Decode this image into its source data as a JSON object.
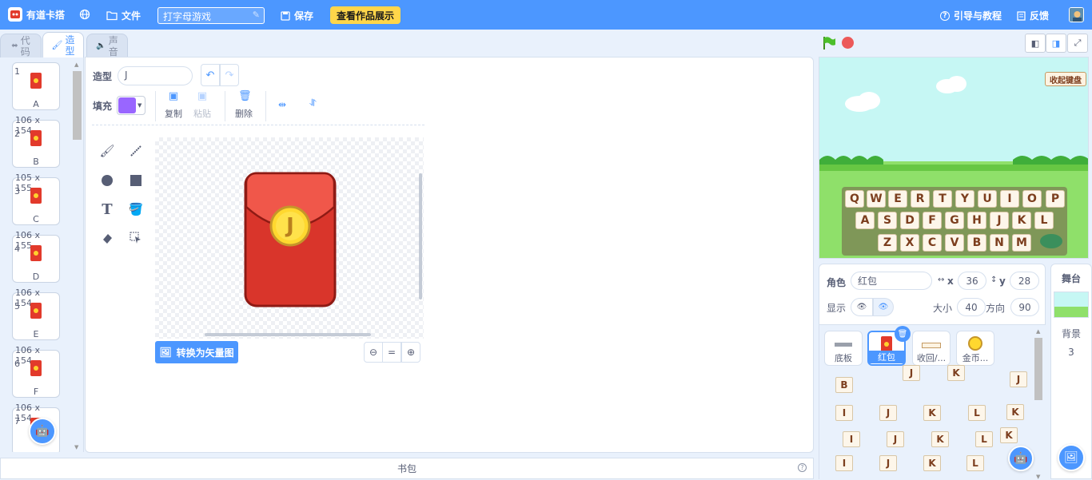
{
  "header": {
    "brand": "有道卡搭",
    "file_label": "文件",
    "project_name": "打字母游戏",
    "save_label": "保存",
    "showcase_label": "查看作品展示",
    "tutorial_label": "引导与教程",
    "feedback_label": "反馈"
  },
  "tabs": [
    {
      "label": "代码",
      "icon": "code-icon"
    },
    {
      "label": "造型",
      "icon": "brush-icon"
    },
    {
      "label": "声音",
      "icon": "speaker-icon"
    }
  ],
  "costumes": [
    {
      "num": "1",
      "name": "A",
      "size": ""
    },
    {
      "num": "2",
      "name": "B",
      "size": "106 x 154"
    },
    {
      "num": "3",
      "name": "C",
      "size": "105 x 155"
    },
    {
      "num": "4",
      "name": "D",
      "size": "106 x 155"
    },
    {
      "num": "5",
      "name": "E",
      "size": "106 x 154"
    },
    {
      "num": "6",
      "name": "F",
      "size": "106 x 154"
    },
    {
      "num": "7",
      "name": "",
      "size": "106 x 154"
    }
  ],
  "paint_editor": {
    "costume_label": "造型",
    "costume_name": "J",
    "fill_label": "填充",
    "fill_color": "#9966ff",
    "copy_label": "复制",
    "paste_label": "粘贴",
    "delete_label": "删除",
    "convert_label": "转换为矢量图",
    "envelope_letter": "J"
  },
  "backpack_label": "书包",
  "stage": {
    "fold_keyboard_label": "收起键盘",
    "keyboard_rows": [
      [
        "Q",
        "W",
        "E",
        "R",
        "T",
        "Y",
        "U",
        "I",
        "O",
        "P"
      ],
      [
        "A",
        "S",
        "D",
        "F",
        "G",
        "H",
        "J",
        "K",
        "L"
      ],
      [
        "Z",
        "X",
        "C",
        "V",
        "B",
        "N",
        "M"
      ]
    ]
  },
  "sprite_info": {
    "sprite_label": "角色",
    "sprite_name": "红包",
    "x_label": "x",
    "x_value": "36",
    "y_label": "y",
    "y_value": "28",
    "show_label": "显示",
    "size_label": "大小",
    "size_value": "40",
    "direction_label": "方向",
    "direction_value": "90"
  },
  "sprites": [
    {
      "name": "底板"
    },
    {
      "name": "红包"
    },
    {
      "name": "收回/..."
    },
    {
      "name": "金币..."
    }
  ],
  "letter_sprites": [
    "B",
    "J",
    "K",
    "J",
    "I",
    "J",
    "K",
    "L",
    "K",
    "I",
    "J",
    "K",
    "L",
    "K",
    "I",
    "J",
    "K",
    "L"
  ],
  "stage_panel": {
    "title": "舞台",
    "backdrop_label": "背景",
    "backdrop_count": "3"
  }
}
